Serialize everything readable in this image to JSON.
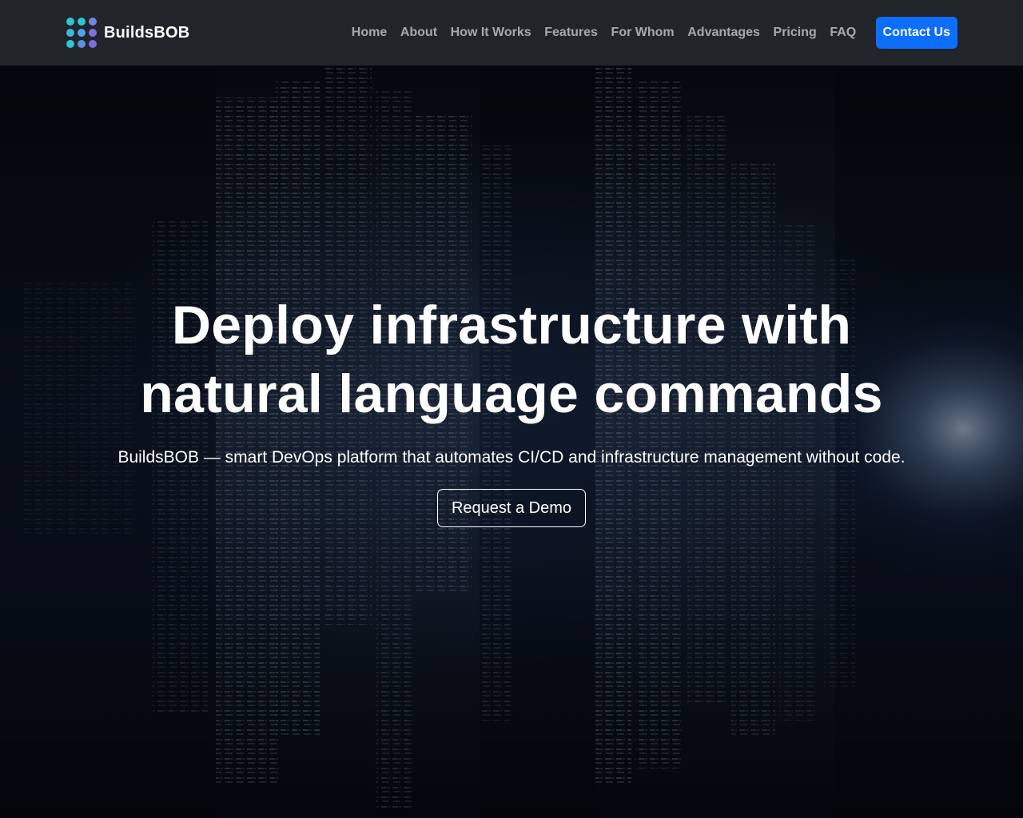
{
  "brand": {
    "name": "BuildsBOB",
    "logo_icon": "dots-grid-logo-icon",
    "logo_colors": [
      "#2ec4d6",
      "#4aa7e8",
      "#7b6ee8"
    ]
  },
  "nav": {
    "items": [
      {
        "label": "Home"
      },
      {
        "label": "About"
      },
      {
        "label": "How It Works"
      },
      {
        "label": "Features"
      },
      {
        "label": "For Whom"
      },
      {
        "label": "Advantages"
      },
      {
        "label": "Pricing"
      },
      {
        "label": "FAQ"
      }
    ],
    "contact_label": "Contact Us"
  },
  "hero": {
    "title_line1": "Deploy infrastructure with",
    "title_line2": "natural language commands",
    "subtitle": "BuildsBOB — smart DevOps platform that automates CI/CD and infrastructure management without code.",
    "cta_label": "Request a Demo",
    "background": "digital-data-stream-image"
  },
  "colors": {
    "navbar_bg": "#212529",
    "accent": "#0d6efd",
    "hero_text": "#ffffff"
  }
}
